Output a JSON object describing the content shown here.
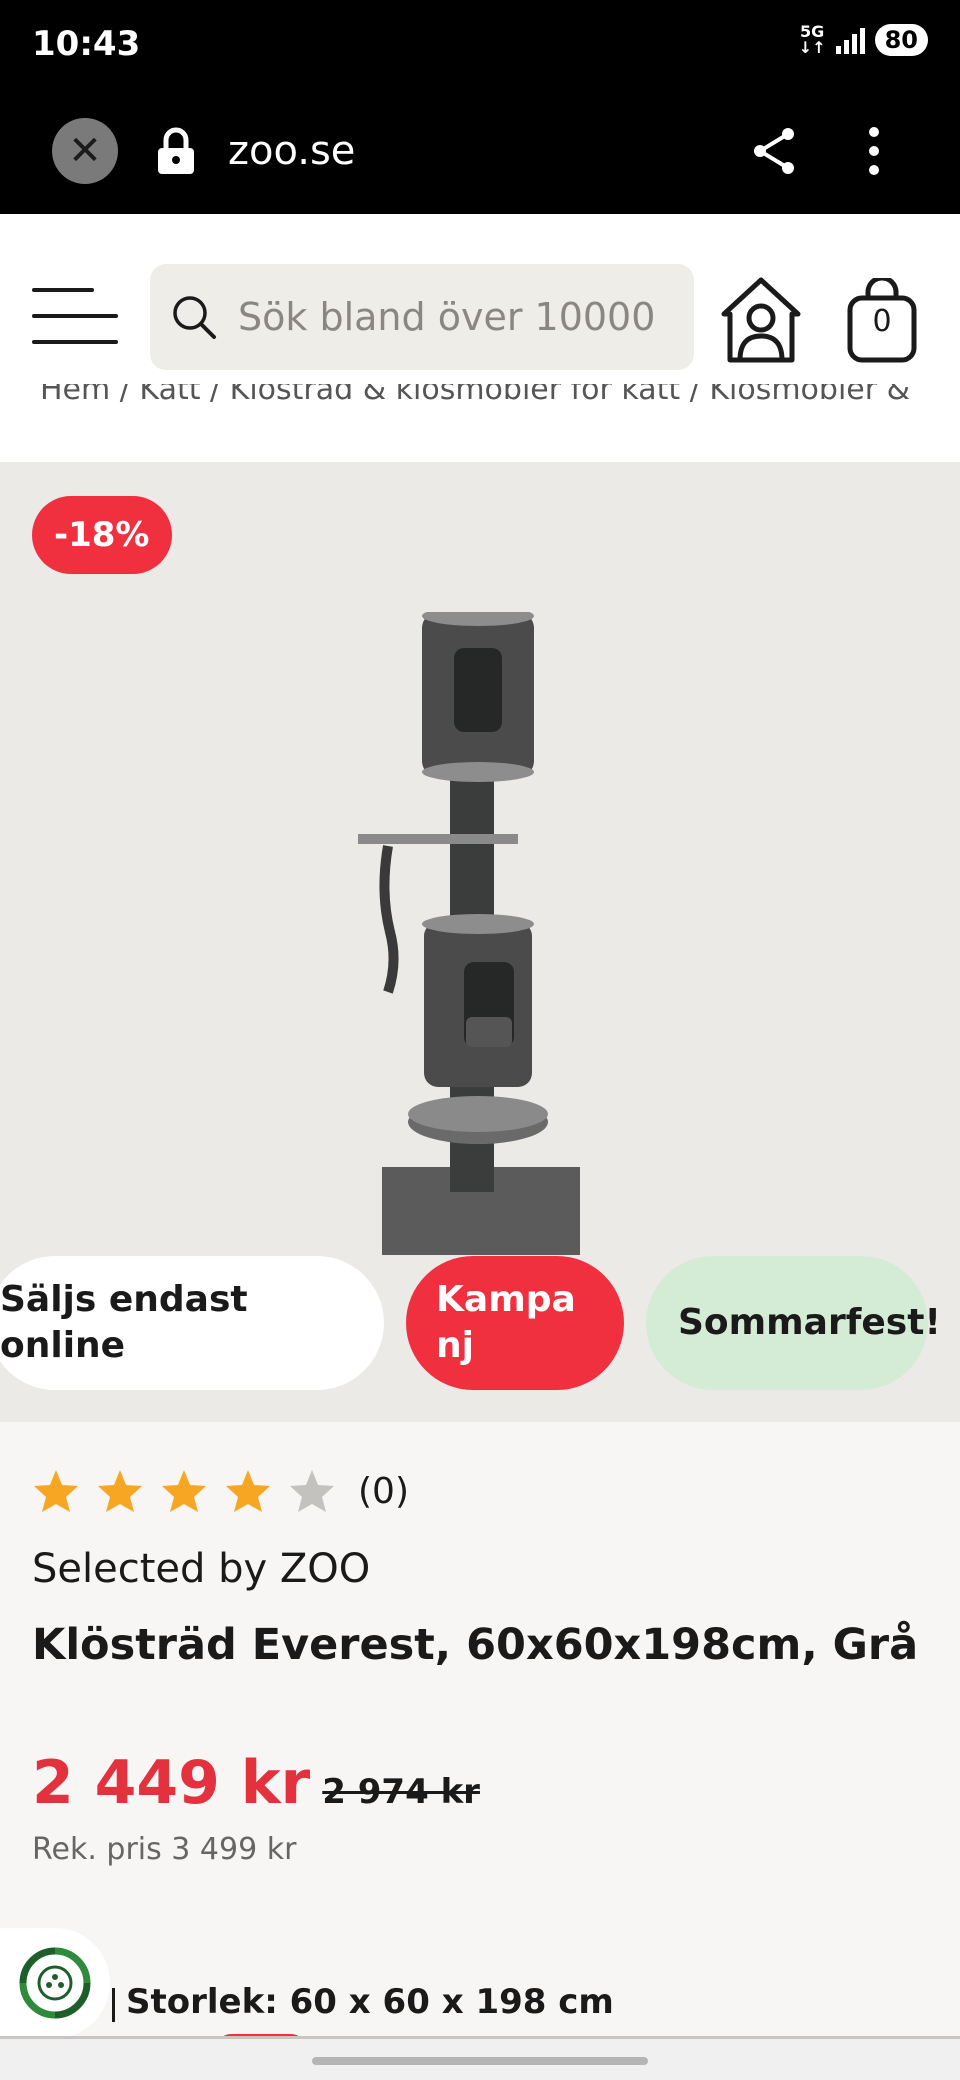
{
  "status_bar": {
    "time": "10:43",
    "network": "5G",
    "battery": "80"
  },
  "browser": {
    "url": "zoo.se"
  },
  "header": {
    "search_placeholder": "Sök bland över 10000",
    "cart_count": "0"
  },
  "breadcrumb": "Hem / Katt / Klösträd & klösmöbler för katt / Klösmöbler &",
  "product": {
    "discount": "-18%",
    "badges": [
      "Säljs endast online",
      "Kampanj",
      "Sommarfest!"
    ],
    "rating": 4,
    "rating_max": 5,
    "rating_count": "(0)",
    "brand": "Selected by ZOO",
    "title": "Klösträd Everest, 60x60x198cm, Grå",
    "price": "2 449 kr",
    "old_price": "2 974 kr",
    "recommended_price": "Rek. pris 3 499 kr",
    "size": "Storlek: 60 x 60 x 198 cm"
  },
  "colors": {
    "accent_red": "#f0303f",
    "star": "#f6a623",
    "star_empty": "#c4c2be",
    "summer_green": "#d4ecd6"
  }
}
